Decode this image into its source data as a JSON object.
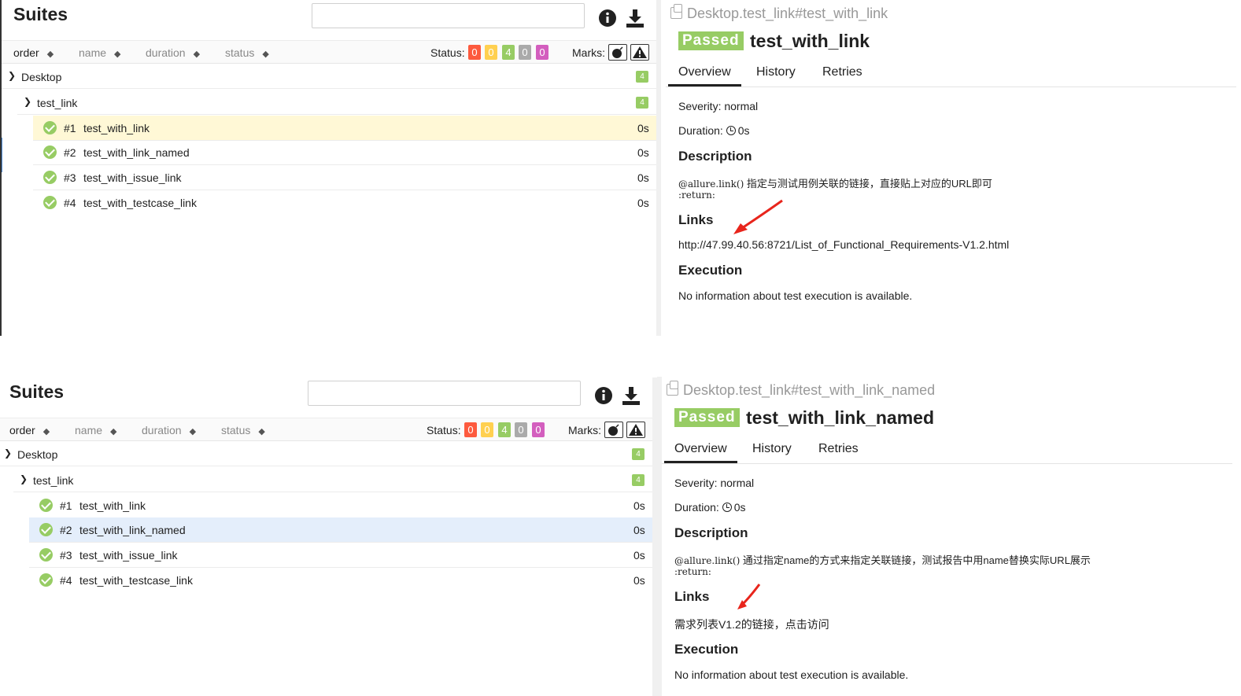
{
  "panels": [
    {
      "suites_title": "Suites",
      "sort": {
        "order": "order",
        "name": "name",
        "duration": "duration",
        "status": "status"
      },
      "status_label": "Status:",
      "status_counts": [
        "0",
        "0",
        "4",
        "0",
        "0"
      ],
      "marks_label": "Marks:",
      "tree": [
        {
          "label": "Desktop",
          "count": "4"
        },
        {
          "label": "test_link",
          "count": "4"
        }
      ],
      "cases": [
        {
          "num": "#1",
          "name": "test_with_link",
          "dur": "0s"
        },
        {
          "num": "#2",
          "name": "test_with_link_named",
          "dur": "0s"
        },
        {
          "num": "#3",
          "name": "test_with_issue_link",
          "dur": "0s"
        },
        {
          "num": "#4",
          "name": "test_with_testcase_link",
          "dur": "0s"
        }
      ],
      "detail": {
        "breadcrumb": "Desktop.test_link#test_with_link",
        "status": "Passed",
        "title": "test_with_link",
        "tabs": [
          "Overview",
          "History",
          "Retries"
        ],
        "severity": "Severity: normal",
        "duration_label": "Duration:",
        "duration_value": "0s",
        "description_heading": "Description",
        "description_code": "@allure.link()",
        "description_text": "指定与测试用例关联的链接，直接贴上对应的URL即可",
        "description_return": ":return:",
        "links_heading": "Links",
        "link": "http://47.99.40.56:8721/List_of_Functional_Requirements-V1.2.html",
        "execution_heading": "Execution",
        "execution_text": "No information about test execution is available."
      }
    },
    {
      "suites_title": "Suites",
      "sort": {
        "order": "order",
        "name": "name",
        "duration": "duration",
        "status": "status"
      },
      "status_label": "Status:",
      "status_counts": [
        "0",
        "0",
        "4",
        "0",
        "0"
      ],
      "marks_label": "Marks:",
      "tree": [
        {
          "label": "Desktop",
          "count": "4"
        },
        {
          "label": "test_link",
          "count": "4"
        }
      ],
      "cases": [
        {
          "num": "#1",
          "name": "test_with_link",
          "dur": "0s"
        },
        {
          "num": "#2",
          "name": "test_with_link_named",
          "dur": "0s"
        },
        {
          "num": "#3",
          "name": "test_with_issue_link",
          "dur": "0s"
        },
        {
          "num": "#4",
          "name": "test_with_testcase_link",
          "dur": "0s"
        }
      ],
      "detail": {
        "breadcrumb": "Desktop.test_link#test_with_link_named",
        "status": "Passed",
        "title": "test_with_link_named",
        "tabs": [
          "Overview",
          "History",
          "Retries"
        ],
        "severity": "Severity: normal",
        "duration_label": "Duration:",
        "duration_value": "0s",
        "description_heading": "Description",
        "description_code": "@allure.link()",
        "description_text": "通过指定name的方式来指定关联链接，测试报告中用name替换实际URL展示",
        "description_return": ":return:",
        "links_heading": "Links",
        "link": "需求列表V1.2的链接，点击访问",
        "execution_heading": "Execution",
        "execution_text": "No information about test execution is available."
      }
    }
  ],
  "colors": {
    "status_badges": [
      "#fd5a3e",
      "#ffd050",
      "#97cc64",
      "#aaaaaa",
      "#d35ebe"
    ],
    "passed": "#97cc64",
    "selected_row_1": "#fff8d6",
    "selected_row_2": "#e4eefb",
    "annotation_arrow": "#e8251c"
  }
}
